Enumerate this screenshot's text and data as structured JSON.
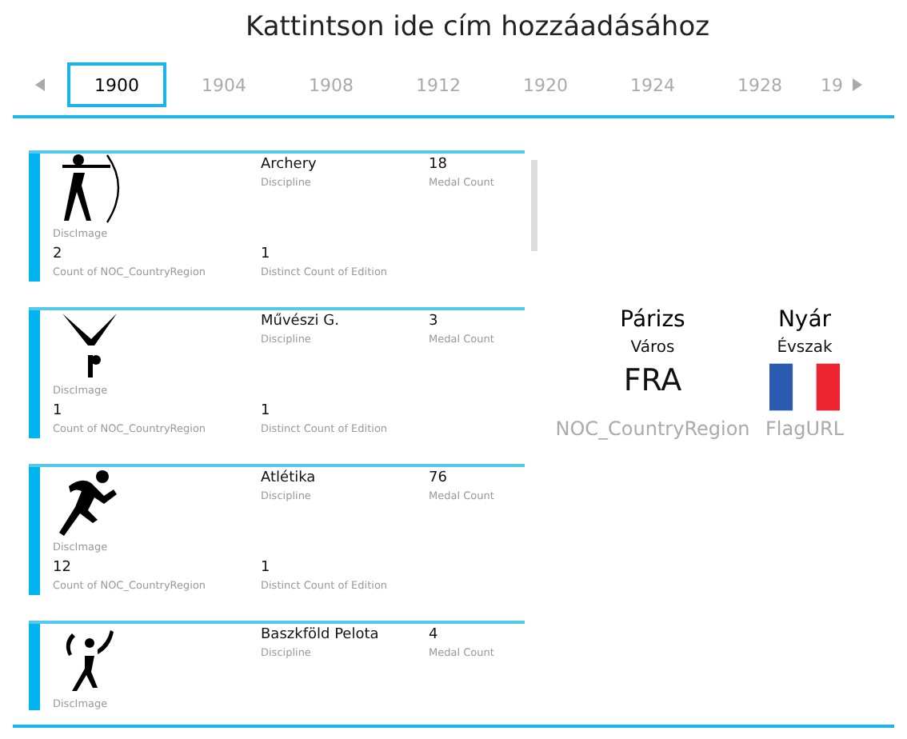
{
  "title": "Kattintson ide cím hozzáadásához",
  "years": [
    {
      "label": "1900",
      "selected": true
    },
    {
      "label": "1904",
      "selected": false
    },
    {
      "label": "1908",
      "selected": false
    },
    {
      "label": "1912",
      "selected": false
    },
    {
      "label": "1920",
      "selected": false
    },
    {
      "label": "1924",
      "selected": false
    },
    {
      "label": "1928",
      "selected": false
    },
    {
      "label": "19",
      "selected": false
    }
  ],
  "cards": [
    {
      "kind": "archery",
      "image_label": "DiscImage",
      "discipline": "Archery",
      "discipline_label": "Discipline",
      "medal_count": "18",
      "medal_label": "Medal Count",
      "country_count": "2",
      "country_label": "Count of NOC_CountryRegion",
      "edition_count": "1",
      "edition_label": "Distinct Count of Edition"
    },
    {
      "kind": "art",
      "image_label": "DiscImage",
      "discipline": "Művészi G.",
      "discipline_label": "Discipline",
      "medal_count": "3",
      "medal_label": "Medal Count",
      "country_count": "1",
      "country_label": "Count of NOC_CountryRegion",
      "edition_count": "1",
      "edition_label": "Distinct Count of Edition"
    },
    {
      "kind": "athletics",
      "image_label": "DiscImage",
      "discipline": "Atlétika",
      "discipline_label": "Discipline",
      "medal_count": "76",
      "medal_label": "Medal Count",
      "country_count": "12",
      "country_label": "Count of NOC_CountryRegion",
      "edition_count": "1",
      "edition_label": "Distinct Count of Edition"
    },
    {
      "kind": "pelota",
      "image_label": "DiscImage",
      "discipline": "Baszkföld Pelota",
      "discipline_label": "Discipline",
      "medal_count": "4",
      "medal_label": "Medal Count"
    }
  ],
  "details": {
    "city": "Párizs",
    "city_label": "Város",
    "season": "Nyár",
    "season_label": "Évszak",
    "noc": "FRA",
    "noc_label": "NOC_CountryRegion",
    "flag_label": "FlagURL"
  }
}
